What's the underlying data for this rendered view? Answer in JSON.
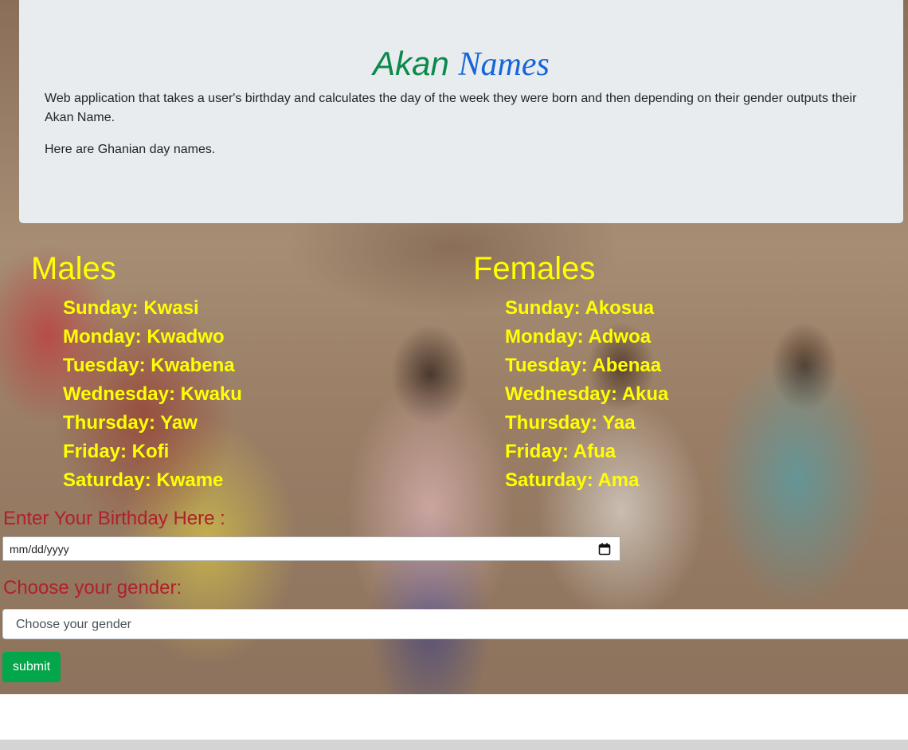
{
  "header": {
    "title_part1": "Akan",
    "title_part2": "Names",
    "description": "Web application that takes a user's birthday and calculates the day of the week they were born and then depending on their gender outputs their Akan Name.",
    "subdescription": "Here are Ghanian day names."
  },
  "males": {
    "heading": "Males",
    "items": [
      "Sunday: Kwasi",
      "Monday: Kwadwo",
      "Tuesday: Kwabena",
      "Wednesday: Kwaku",
      "Thursday: Yaw",
      "Friday: Kofi",
      "Saturday: Kwame"
    ]
  },
  "females": {
    "heading": "Females",
    "items": [
      "Sunday: Akosua",
      "Monday: Adwoa",
      "Tuesday: Abenaa",
      "Wednesday: Akua",
      "Thursday: Yaa",
      "Friday: Afua",
      "Saturday: Ama"
    ]
  },
  "form": {
    "birthday_label": "Enter Your Birthday Here :",
    "birthday_placeholder": "mm/dd/yyyy",
    "gender_label": "Choose your gender:",
    "gender_selected": "Choose your gender",
    "submit_label": "submit"
  },
  "colors": {
    "heading_yellow": "#ffff00",
    "label_red": "#b0202a",
    "akan_green": "#0b8a4c",
    "names_blue": "#1466d8",
    "submit_green": "#03a64a",
    "jumbotron_bg": "#e9ecef"
  },
  "icons": {
    "date_picker": "calendar-icon"
  }
}
